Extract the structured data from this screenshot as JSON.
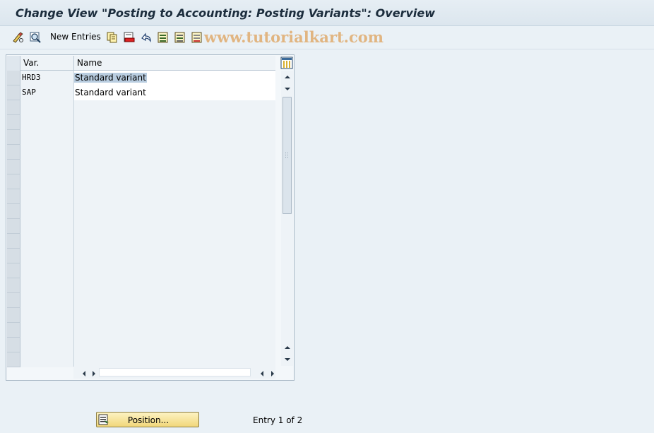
{
  "window": {
    "title": "Change View \"Posting to Accounting: Posting Variants\": Overview"
  },
  "toolbar": {
    "new_entries_label": "New Entries",
    "icons": [
      "edit-glasses-icon",
      "details-icon",
      "copy-icon",
      "delete-icon",
      "undo-icon",
      "select-all-icon",
      "select-block-icon",
      "deselect-all-icon"
    ]
  },
  "watermark": "www.tutorialkart.com",
  "table": {
    "columns": [
      "Var.",
      "Name"
    ],
    "rows": [
      {
        "var": "HRD3",
        "name": "Standard variant"
      },
      {
        "var": "SAP",
        "name": "Standard variant"
      }
    ],
    "empty_row_count": 18
  },
  "footer": {
    "position_label": "Position...",
    "entry_info": "Entry 1 of 2"
  },
  "colors": {
    "button_bg": "#f1d77a",
    "highlight": "#b9cde0"
  }
}
